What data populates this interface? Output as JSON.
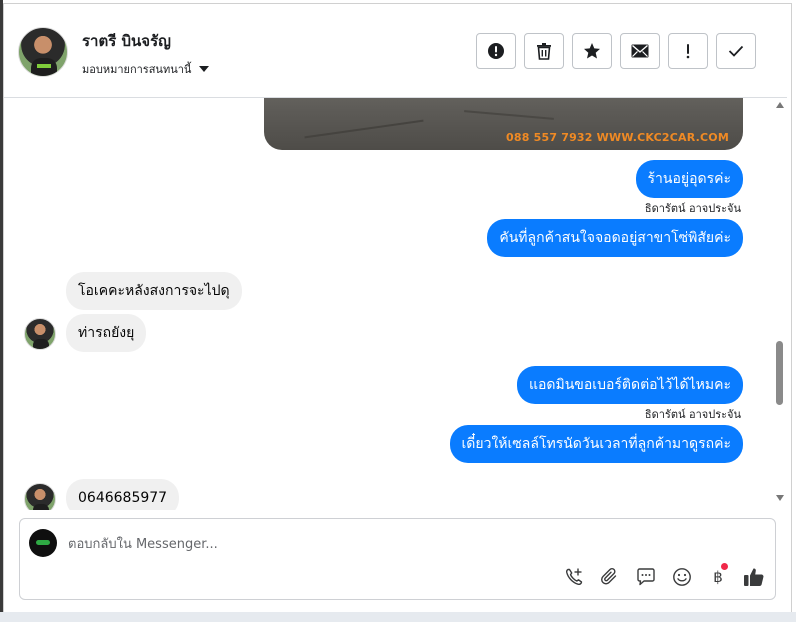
{
  "header": {
    "contact_name": "ราตรี บินจรัญ",
    "assign_label": "มอบหมายการสนทนานี้",
    "actions": [
      {
        "icon": "alert-circle-icon",
        "label": "Mark as spam"
      },
      {
        "icon": "trash-icon",
        "label": "Delete"
      },
      {
        "icon": "star-icon",
        "label": "Star"
      },
      {
        "icon": "envelope-icon",
        "label": "Mark as unread"
      },
      {
        "icon": "exclamation-icon",
        "label": "Follow up"
      },
      {
        "icon": "check-icon",
        "label": "Done"
      }
    ]
  },
  "photo": {
    "watermark": "088 557 7932 WWW.CKC2CAR.COM"
  },
  "messages": [
    {
      "direction": "out",
      "text": "ร้านอยู่อุดรค่ะ"
    },
    {
      "direction": "out",
      "sender": "ธิดารัตน์ อาจประจัน",
      "text": "คันที่ลูกค้าสนใจจอดอยู่สาขาโซ่พิสัยค่ะ"
    },
    {
      "direction": "in",
      "text": "โอเคคะหลังสงการจะไปดุ"
    },
    {
      "direction": "in",
      "text": "ท่ารถยังยุ"
    },
    {
      "direction": "out",
      "text": "แอดมินขอเบอร์ติดต่อไว้ได้ไหมคะ"
    },
    {
      "direction": "out",
      "sender": "ธิดารัตน์ อาจประจัน",
      "text": "เดี๋ยวให้เซลล์โทรนัดวันเวลาที่ลูกค้ามาดูรถค่ะ"
    },
    {
      "direction": "in",
      "text": "0646685977"
    }
  ],
  "composer": {
    "placeholder": "ตอบกลับใน Messenger...",
    "tools": [
      "phone-plus-icon",
      "paperclip-icon",
      "chat-bubble-icon",
      "emoji-icon",
      "baht-icon",
      "thumbs-up-icon"
    ],
    "baht_symbol": "฿",
    "notification_color": "#f02849"
  },
  "colors": {
    "outgoing_bubble": "#0a7cff",
    "incoming_bubble": "#f0f0f0",
    "watermark": "#f08a24"
  }
}
